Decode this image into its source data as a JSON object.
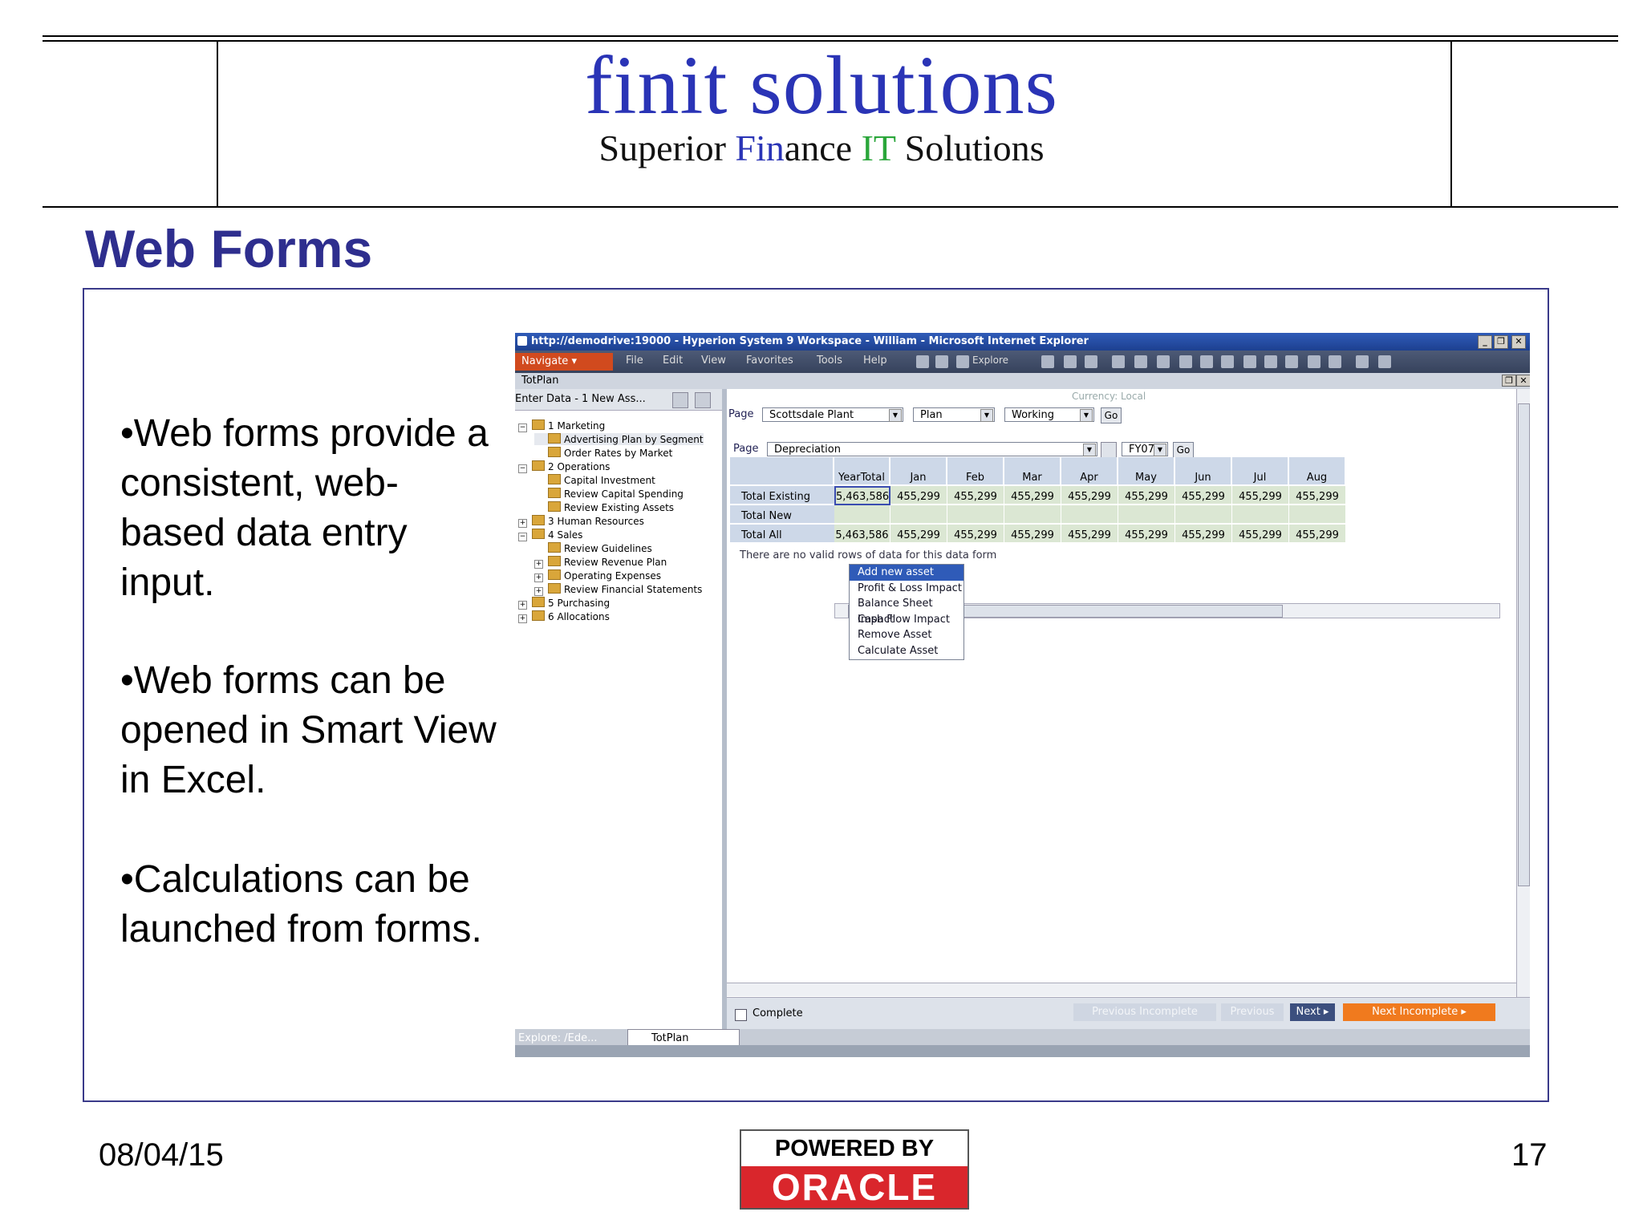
{
  "header": {
    "brand": "finit solutions",
    "tagline": {
      "part1": "Superior ",
      "part2": "Fin",
      "part3": "ance ",
      "part4": "IT",
      "part5": " Solutions"
    }
  },
  "slide": {
    "title": "Web Forms",
    "bullets": [
      "•Web forms provide a consistent, web-based data entry input.",
      "•Web forms can be opened in Smart View in Excel.",
      "•Calculations can be launched from forms."
    ],
    "date": "08/04/15",
    "page_number": "17",
    "logo": {
      "top": "POWERED BY",
      "bottom": "ORACLE"
    }
  },
  "browser": {
    "title": "http://demodrive:19000 - Hyperion System 9 Workspace - William - Microsoft Internet Explorer",
    "navigate": "Navigate",
    "menu": [
      "File",
      "Edit",
      "View",
      "Favorites",
      "Tools",
      "Help"
    ],
    "explore": "Explore",
    "tab": "TotPlan"
  },
  "left_pane": {
    "header": "Enter Data - 1 New Ass...",
    "tree": [
      {
        "label": "1 Marketing",
        "level": 0,
        "pm": "−"
      },
      {
        "label": "Advertising Plan by Segment",
        "level": 1,
        "pm": ""
      },
      {
        "label": "Order Rates by Market",
        "level": 1,
        "pm": ""
      },
      {
        "label": "2 Operations",
        "level": 0,
        "pm": "−"
      },
      {
        "label": "Capital Investment",
        "level": 1,
        "pm": ""
      },
      {
        "label": "Review Capital Spending",
        "level": 1,
        "pm": ""
      },
      {
        "label": "Review Existing Assets",
        "level": 1,
        "pm": ""
      },
      {
        "label": "3 Human Resources",
        "level": 0,
        "pm": "+"
      },
      {
        "label": "4 Sales",
        "level": 0,
        "pm": "−"
      },
      {
        "label": "Review Guidelines",
        "level": 1,
        "pm": ""
      },
      {
        "label": "Review Revenue Plan",
        "level": 1,
        "pm": "+"
      },
      {
        "label": "Operating Expenses",
        "level": 1,
        "pm": "+"
      },
      {
        "label": "Review Financial Statements",
        "level": 1,
        "pm": "+"
      },
      {
        "label": "5 Purchasing",
        "level": 0,
        "pm": "+"
      },
      {
        "label": "6 Allocations",
        "level": 0,
        "pm": "+"
      }
    ]
  },
  "form": {
    "currency": "Currency: Local",
    "page_label": "Page",
    "page1": {
      "entity": "Scottsdale Plant",
      "scenario": "Plan",
      "version": "Working",
      "go": "Go"
    },
    "page2": {
      "account": "Depreciation",
      "year": "FY07",
      "go": "Go"
    },
    "columns": [
      "YearTotal",
      "Jan",
      "Feb",
      "Mar",
      "Apr",
      "May",
      "Jun",
      "Jul",
      "Aug"
    ],
    "rows": [
      {
        "label": "Total Existing",
        "values": [
          "5,463,586",
          "455,299",
          "455,299",
          "455,299",
          "455,299",
          "455,299",
          "455,299",
          "455,299",
          "455,299"
        ]
      },
      {
        "label": "Total New",
        "values": [
          "",
          "",
          "",
          "",
          "",
          "",
          "",
          "",
          ""
        ]
      },
      {
        "label": "Total All",
        "values": [
          "5,463,586",
          "455,299",
          "455,299",
          "455,299",
          "455,299",
          "455,299",
          "455,299",
          "455,299",
          "455,299"
        ]
      }
    ],
    "no_rows_message": "There are no valid rows of data for this data form",
    "context_menu": [
      "Add new asset",
      "Profit & Loss Impact",
      "Balance Sheet Impact",
      "Cash Flow Impact",
      "Remove Asset",
      "Calculate Asset"
    ],
    "complete_label": "Complete",
    "nav": {
      "prev_incomplete": "Previous Incomplete",
      "previous": "Previous",
      "next": "Next ▸",
      "next_incomplete": "Next Incomplete ▸"
    }
  },
  "status": {
    "tab1": "Explore: /Ede...",
    "tab2": "TotPlan"
  }
}
